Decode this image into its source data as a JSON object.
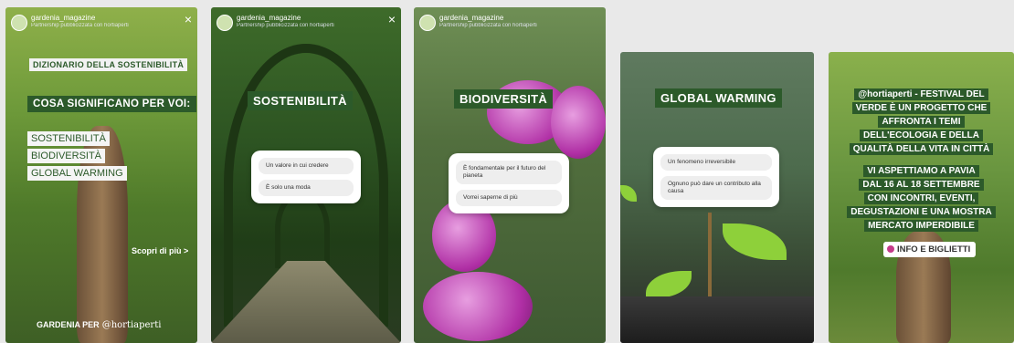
{
  "stories": {
    "s1": {
      "account": "gardenia_magazine",
      "subtitle": "Partnership pubblicizzata con hortiaperti",
      "close_icon": "close-icon",
      "label": "DIZIONARIO DELLA SOSTENIBILITÀ",
      "heading": "COSA SIGNIFICANO PER VOI:",
      "terms": [
        "SOSTENIBILITÀ",
        "BIODIVERSITÀ",
        "GLOBAL WARMING"
      ],
      "cta": "Scopri di più >",
      "footer_text": "GARDENIA PER",
      "footer_handle": "@hortiaperti"
    },
    "s2": {
      "account": "gardenia_magazine",
      "subtitle": "Partnership pubblicizzata con hortiaperti",
      "title": "SOSTENIBILITÀ",
      "options": [
        "Un valore in cui credere",
        "È solo una moda"
      ]
    },
    "s3": {
      "account": "gardenia_magazine",
      "subtitle": "Partnership pubblicizzata con hortiaperti",
      "title": "BIODIVERSITÀ",
      "options": [
        "È fondamentale per il futuro del pianeta",
        "Vorrei saperne di più"
      ]
    },
    "s4": {
      "title": "GLOBAL WARMING",
      "options": [
        "Un fenomeno irreversibile",
        "Ognuno può dare un contributo alla causa"
      ]
    },
    "s5": {
      "lines1": [
        "@hortiaperti  - FESTIVAL DEL",
        "VERDE È UN PROGETTO CHE",
        "AFFRONTA I TEMI",
        "DELL'ECOLOGIA E DELLA",
        "QUALITÀ DELLA VITA IN CITTÀ"
      ],
      "lines2": [
        "VI ASPETTIAMO A PAVIA",
        "DAL 16 AL 18 SETTEMBRE",
        "CON INCONTRI, EVENTI,",
        "DEGUSTAZIONI E UNA MOSTRA",
        "MERCATO IMPERDIBILE"
      ],
      "button": "INFO E BIGLIETTI"
    }
  }
}
